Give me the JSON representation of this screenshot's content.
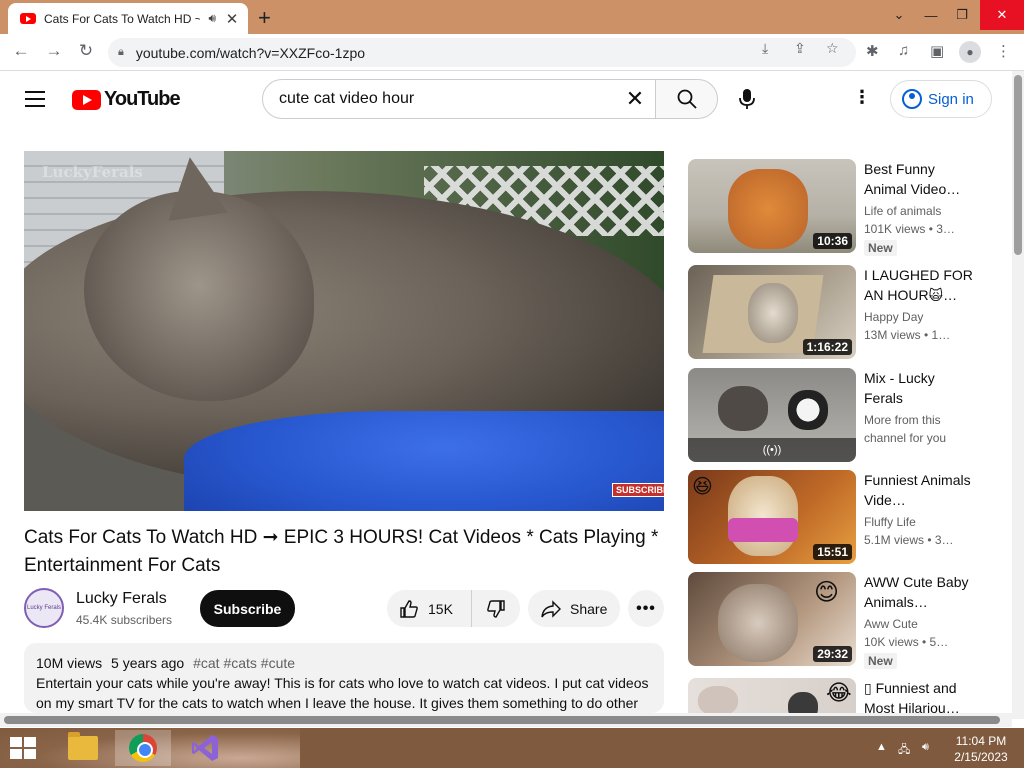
{
  "browser": {
    "tab_title": "Cats For Cats To Watch HD ~",
    "url": "youtube.com/watch?v=XXZFco-1zpo"
  },
  "header": {
    "logo_text": "YouTube",
    "search_value": "cute cat video hour",
    "sign_in": "Sign in"
  },
  "player": {
    "watermark": "LuckyFerals",
    "subscribe_overlay": "SUBSCRIBE"
  },
  "video": {
    "title": "Cats For Cats To Watch HD ➞ EPIC 3 HOURS! Cat Videos * Cats Playing * Entertainment For Cats",
    "channel": "Lucky Ferals",
    "avatar_text": "Lucky Ferals",
    "subscribers": "45.4K subscribers",
    "subscribe": "Subscribe",
    "likes": "15K",
    "share": "Share",
    "more": "•••",
    "views": "10M views",
    "age": "5 years ago",
    "tags": "#cat #cats #cute",
    "description": "Entertain your cats while you're away! This is for cats who love to watch cat videos. I put cat videos on my smart TV for the cats to watch when I leave the house. It gives them something to do other"
  },
  "sidebar": [
    {
      "title": "Best Funny Animal Video…",
      "channel": "Life of animals",
      "views": "101K views  • 3…",
      "duration": "10:36",
      "badge": "New"
    },
    {
      "title": "I LAUGHED FOR AN HOUR🙀…",
      "channel": "Happy Day",
      "views": "13M views  • 1…",
      "duration": "1:16:22",
      "badge": ""
    },
    {
      "title": "Mix - Lucky Ferals",
      "channel": "More from this",
      "views": "channel for you",
      "duration": "",
      "badge": "",
      "live_icon": "((•))"
    },
    {
      "title": "Funniest Animals Vide…",
      "channel": "Fluffy Life",
      "views": "5.1M views  • 3…",
      "duration": "15:51",
      "badge": ""
    },
    {
      "title": "AWW Cute Baby Animals…",
      "channel": "Aww Cute",
      "views": "10K views  • 5…",
      "duration": "29:32",
      "badge": "New"
    },
    {
      "title": "▯ Funniest and Most Hilariou…",
      "channel": "",
      "views": "",
      "duration": "",
      "badge": ""
    }
  ],
  "taskbar": {
    "time": "11:04 PM",
    "date": "2/15/2023"
  },
  "colors": {
    "youtube_red": "#ff0000",
    "link_blue": "#065fd4",
    "tabstrip": "#cc9166",
    "taskbar": "#7f5a3e"
  }
}
